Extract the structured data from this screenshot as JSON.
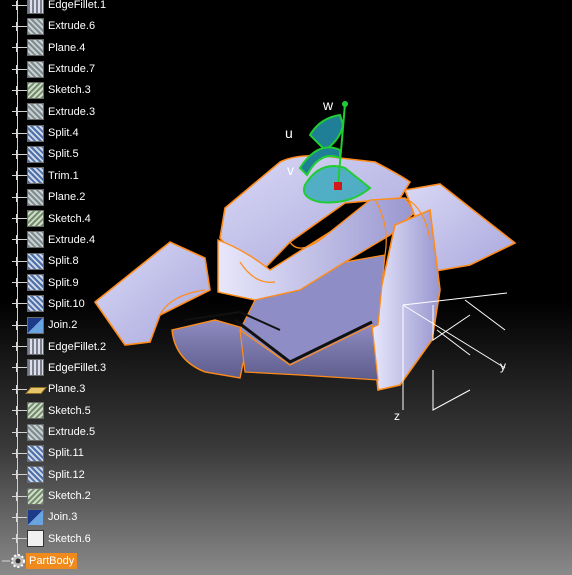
{
  "tree": {
    "items": [
      {
        "label": "EdgeFillet.1",
        "icon": "fillet-icon"
      },
      {
        "label": "Extrude.6",
        "icon": "feature-icon"
      },
      {
        "label": "Plane.4",
        "icon": "feature-icon"
      },
      {
        "label": "Extrude.7",
        "icon": "feature-icon"
      },
      {
        "label": "Sketch.3",
        "icon": "sketch-icon"
      },
      {
        "label": "Extrude.3",
        "icon": "feature-icon"
      },
      {
        "label": "Split.4",
        "icon": "split-icon"
      },
      {
        "label": "Split.5",
        "icon": "split-icon"
      },
      {
        "label": "Trim.1",
        "icon": "split-icon"
      },
      {
        "label": "Plane.2",
        "icon": "feature-icon"
      },
      {
        "label": "Sketch.4",
        "icon": "sketch-icon"
      },
      {
        "label": "Extrude.4",
        "icon": "feature-icon"
      },
      {
        "label": "Split.8",
        "icon": "split-icon"
      },
      {
        "label": "Split.9",
        "icon": "split-icon"
      },
      {
        "label": "Split.10",
        "icon": "split-icon"
      },
      {
        "label": "Join.2",
        "icon": "join-icon"
      },
      {
        "label": "EdgeFillet.2",
        "icon": "fillet-icon"
      },
      {
        "label": "EdgeFillet.3",
        "icon": "fillet-icon"
      },
      {
        "label": "Plane.3",
        "icon": "plane-icon"
      },
      {
        "label": "Sketch.5",
        "icon": "sketch-icon"
      },
      {
        "label": "Extrude.5",
        "icon": "feature-icon"
      },
      {
        "label": "Split.11",
        "icon": "split-icon"
      },
      {
        "label": "Split.12",
        "icon": "split-icon"
      },
      {
        "label": "Sketch.2",
        "icon": "sketch-icon"
      },
      {
        "label": "Join.3",
        "icon": "join-icon"
      },
      {
        "label": "Sketch.6",
        "icon": "sketch-icon"
      }
    ],
    "root": {
      "label": "PartBody",
      "icon": "gear-icon"
    }
  },
  "compass": {
    "u": "u",
    "v": "v",
    "w": "w"
  },
  "axes": {
    "y": "y",
    "z": "z"
  },
  "colors": {
    "selection": "#f08a1c",
    "model_surface": "#b9b8e6",
    "edge_highlight": "#ff8c1a",
    "compass_green": "#22cc33",
    "compass_fill": "#2aa7b8"
  }
}
